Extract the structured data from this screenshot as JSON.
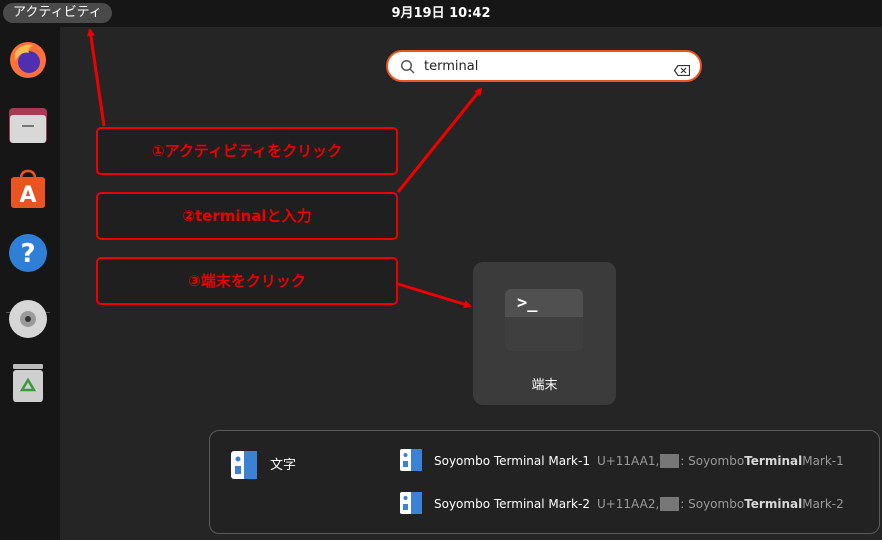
{
  "topbar": {
    "activities_label": "アクティビティ",
    "clock": "9月19日  10:42"
  },
  "dock": {
    "apps": [
      {
        "name": "firefox-icon"
      },
      {
        "name": "files-icon"
      },
      {
        "name": "app-center-icon"
      },
      {
        "name": "help-icon"
      },
      {
        "name": "disc-icon"
      },
      {
        "name": "trash-icon"
      }
    ]
  },
  "search": {
    "value": "terminal",
    "placeholder": ""
  },
  "annotations": {
    "step1": "①アクティビティをクリック",
    "step2": "②terminalと入力",
    "step3": "③端末をクリック"
  },
  "app_result": {
    "label": "端末",
    "prompt": ">_"
  },
  "characters": {
    "provider": "文字",
    "items": [
      {
        "name": "Soyombo Terminal Mark-1",
        "code": "U+11AA1,",
        "desc_pre": ": Soyombo ",
        "desc_bold": "Terminal",
        "desc_post": " Mark-1"
      },
      {
        "name": "Soyombo Terminal Mark-2",
        "code": "U+11AA2,",
        "desc_pre": ": Soyombo ",
        "desc_bold": "Terminal",
        "desc_post": " Mark-2"
      }
    ]
  },
  "colors": {
    "accent": "#e95420",
    "annotation": "#ee0000",
    "panel": "#161616"
  }
}
